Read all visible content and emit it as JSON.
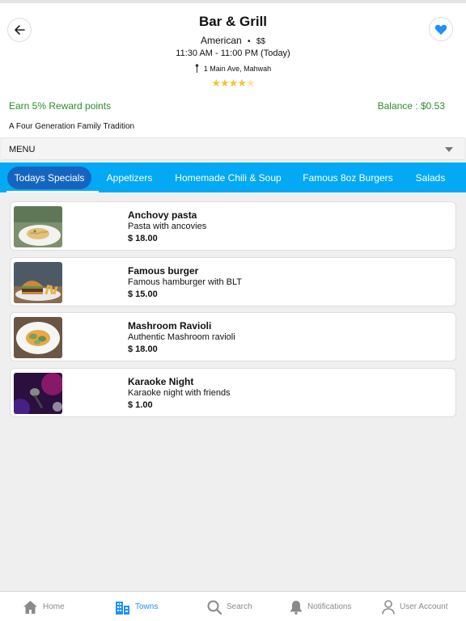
{
  "header": {
    "title": "Bar & Grill",
    "cuisine": "American",
    "price_level": "$$",
    "hours": "11:30 AM - 11:00 PM (Today)",
    "address": "1 Main Ave, Mahwah",
    "rating": 4.5
  },
  "rewards": {
    "earn_label": "Earn 5%  Reward points",
    "balance_label": "Balance : $0.53"
  },
  "tagline": "A Four Generation Family Tradition",
  "menu_selector": {
    "label": "MENU"
  },
  "tabs": [
    {
      "label": "Todays Specials",
      "active": true
    },
    {
      "label": "Appetizers"
    },
    {
      "label": "Homemade Chili & Soup"
    },
    {
      "label": "Famous 8oz Burgers"
    },
    {
      "label": "Salads"
    }
  ],
  "items": [
    {
      "name": "Anchovy pasta",
      "description": "Pasta with ancovies",
      "price": "$ 18.00"
    },
    {
      "name": "Famous burger",
      "description": "Famous hamburger with BLT",
      "price": "$ 15.00"
    },
    {
      "name": "Mashroom Ravioli",
      "description": "Authentic Mashroom ravioli",
      "price": "$ 18.00"
    },
    {
      "name": "Karaoke Night",
      "description": "Karaoke night with friends",
      "price": "$ 1.00"
    }
  ],
  "bottom_nav": [
    {
      "label": "Home",
      "icon": "home-icon"
    },
    {
      "label": "Towns",
      "icon": "buildings-icon",
      "active": true
    },
    {
      "label": "Search",
      "icon": "search-icon"
    },
    {
      "label": "Notifications",
      "icon": "bell-icon"
    },
    {
      "label": "User Account",
      "icon": "user-icon"
    }
  ],
  "colors": {
    "accent": "#03a9f4",
    "active_tab": "#1565c0",
    "reward_green": "#2e8b2e",
    "favorite": "#1e90ff"
  }
}
